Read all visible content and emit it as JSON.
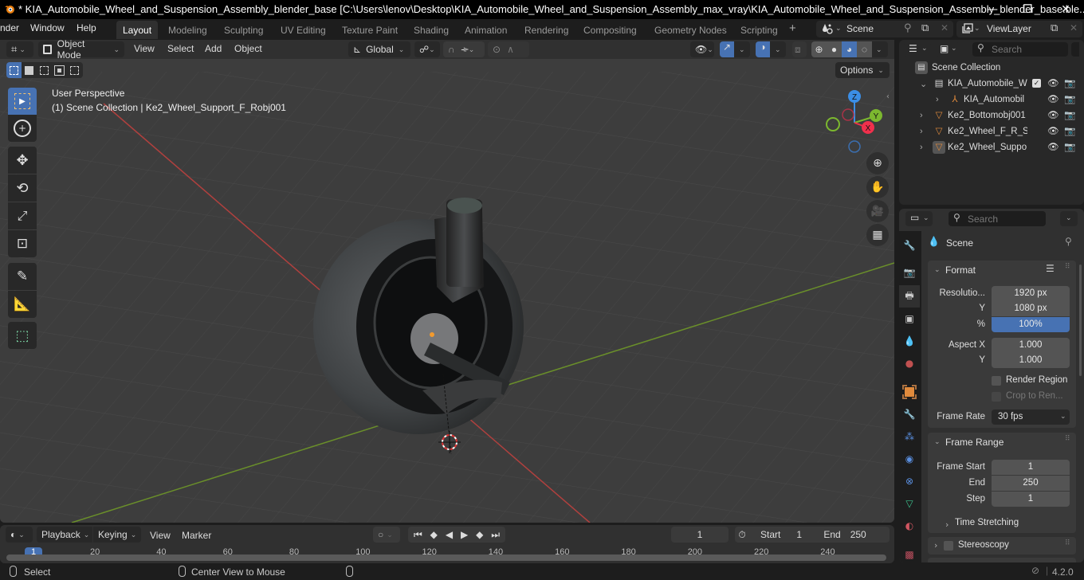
{
  "window": {
    "title": "* KIA_Automobile_Wheel_and_Suspension_Assembly_blender_base [C:\\Users\\lenov\\Desktop\\KIA_Automobile_Wheel_and_Suspension_Assembly_max_vray\\KIA_Automobile_Wheel_and_Suspension_Assembly_blender_base.ble...",
    "minimize": "—",
    "restore": "❐",
    "close": "✕"
  },
  "menubar": {
    "menus": [
      "nder",
      "Window",
      "Help"
    ],
    "workspaces": [
      "Layout",
      "Modeling",
      "Sculpting",
      "UV Editing",
      "Texture Paint",
      "Shading",
      "Animation",
      "Rendering",
      "Compositing",
      "Geometry Nodes",
      "Scripting"
    ],
    "active_workspace": "Layout",
    "add_workspace": "+",
    "scene": "Scene",
    "view_layer": "ViewLayer"
  },
  "viewport": {
    "mode": "Object Mode",
    "menus": [
      "View",
      "Select",
      "Add",
      "Object"
    ],
    "transform_orientation": "Global",
    "options_label": "Options",
    "overlay_text_1": "User Perspective",
    "overlay_text_2": "(1) Scene Collection | Ke2_Wheel_Support_F_Robj001",
    "gizmo": {
      "z": "Z",
      "y": "Y",
      "x": "X"
    },
    "colors": {
      "x_axis": "#f0304c",
      "y_axis": "#7cb82f",
      "z_axis": "#3b8ee6",
      "accent": "#4772b3"
    }
  },
  "outliner": {
    "search_placeholder": "Search",
    "root": "Scene Collection",
    "items": [
      {
        "label": "KIA_Automobile_W",
        "depth": 1,
        "type": "collection",
        "expanded": true
      },
      {
        "label": "KIA_Automobil",
        "depth": 2,
        "type": "empty",
        "expanded": false
      },
      {
        "label": "Ke2_Bottomobj001",
        "depth": 1,
        "type": "mesh",
        "expanded": false
      },
      {
        "label": "Ke2_Wheel_F_R_Su",
        "depth": 1,
        "type": "mesh",
        "expanded": false
      },
      {
        "label": "Ke2_Wheel_Suppoı",
        "depth": 1,
        "type": "mesh",
        "expanded": false,
        "active": true
      }
    ]
  },
  "properties": {
    "search_placeholder": "Search",
    "context": "Scene",
    "format": {
      "title": "Format",
      "resolution_label": "Resolutio...",
      "resolution_x": "1920 px",
      "y_label": "Y",
      "resolution_y": "1080 px",
      "percent_label": "%",
      "percent": "100%",
      "aspect_x_label": "Aspect X",
      "aspect_x": "1.000",
      "aspect_y_label": "Y",
      "aspect_y": "1.000",
      "render_region": "Render Region",
      "crop": "Crop to Ren...",
      "frame_rate_label": "Frame Rate",
      "frame_rate": "30 fps"
    },
    "frame_range": {
      "title": "Frame Range",
      "start_label": "Frame Start",
      "start": "1",
      "end_label": "End",
      "end": "250",
      "step_label": "Step",
      "step": "1",
      "time_stretching": "Time Stretching"
    },
    "stereoscopy": "Stereoscopy"
  },
  "timeline": {
    "menus": [
      "Playback",
      "Keying",
      "View",
      "Marker"
    ],
    "current_frame": "1",
    "start_label": "Start",
    "start": "1",
    "end_label": "End",
    "end": "250",
    "ticks": [
      "20",
      "40",
      "60",
      "80",
      "100",
      "120",
      "140",
      "160",
      "180",
      "200",
      "220",
      "240"
    ],
    "playhead": "1"
  },
  "statusbar": {
    "select": "Select",
    "center_view": "Center View to Mouse",
    "version": "4.2.0"
  }
}
